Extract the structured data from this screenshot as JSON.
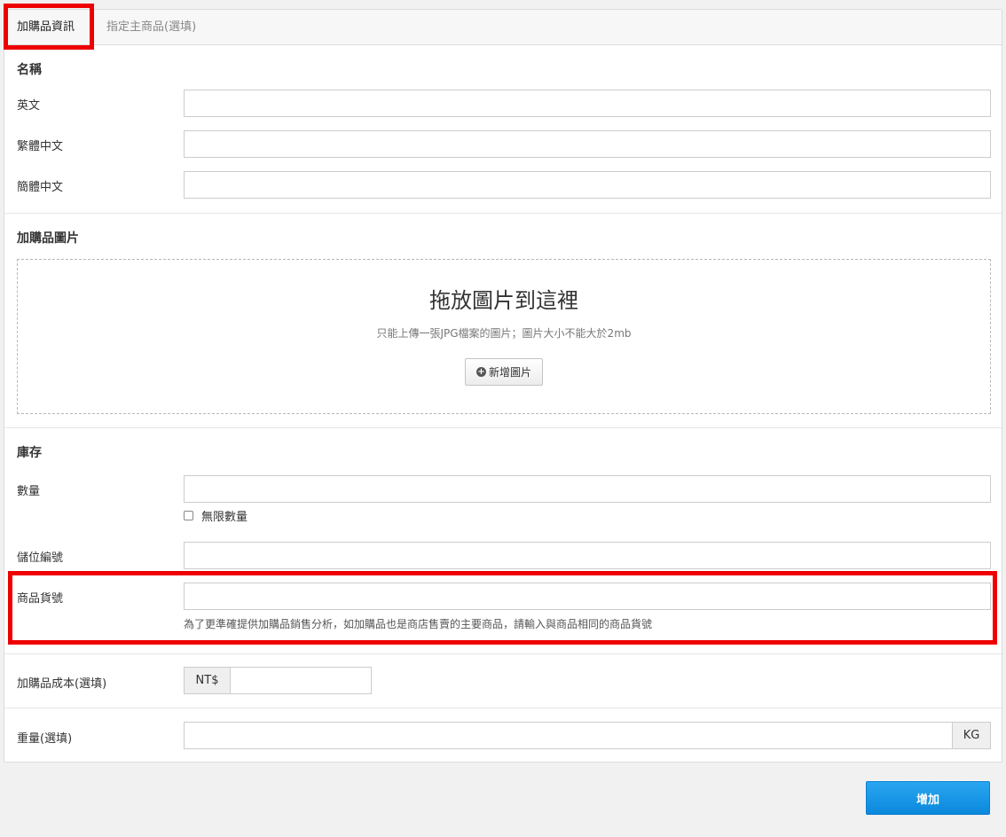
{
  "tabs": {
    "active": "加購品資訊",
    "other": "指定主商品(選填)"
  },
  "name_section": {
    "title": "名稱",
    "fields": [
      {
        "label": "英文",
        "value": ""
      },
      {
        "label": "繁體中文",
        "value": ""
      },
      {
        "label": "簡體中文",
        "value": ""
      }
    ]
  },
  "image_section": {
    "title": "加購品圖片",
    "drop_title": "拖放圖片到這裡",
    "drop_hint": "只能上傳一張JPG檔案的圖片；圖片大小不能大於2mb",
    "add_button": "新增圖片"
  },
  "stock_section": {
    "title": "庫存",
    "quantity_label": "數量",
    "unlimited_label": "無限數量",
    "unlimited_checked": false,
    "location_label": "儲位編號",
    "sku_label": "商品貨號",
    "sku_help": "為了更準確提供加購品銷售分析，如加購品也是商店售賣的主要商品，請輸入與商品相同的商品貨號"
  },
  "cost": {
    "label": "加購品成本(選填)",
    "currency": "NT$",
    "value": ""
  },
  "weight": {
    "label": "重量(選填)",
    "unit": "KG",
    "value": ""
  },
  "submit_label": "增加",
  "colors": {
    "highlight": "#ee0000",
    "primary": "#0a88dc"
  }
}
